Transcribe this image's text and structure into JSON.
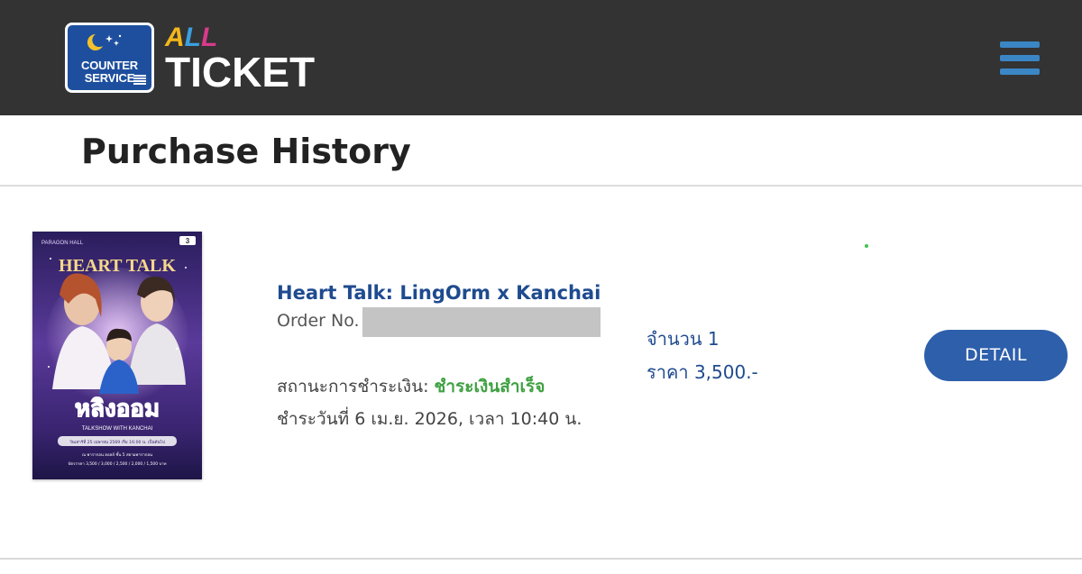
{
  "header": {
    "logo_line1": "COUNTER",
    "logo_line2": "SERVICE",
    "brand_all": [
      "A",
      "L",
      "L"
    ],
    "brand_ticket": "TICKET",
    "menu_icon": "hamburger-menu-icon",
    "colors": {
      "bar": "#333333",
      "menu": "#3b86c4",
      "logo_bg": "#1e4f9e"
    }
  },
  "page": {
    "title": "Purchase History"
  },
  "order": {
    "poster": {
      "venue": "PARAGON HALL",
      "title": "HEART TALK",
      "thai_title": "หลิงออม",
      "subtitle": "TALKSHOW WITH KANCHAI",
      "date_line": "วันเสาร์ที่ 25 เมษายน 2569 เริ่ม 16:00 น. เป็นต้นไป",
      "location_line": "ณ พารากอน ฮอลล์ ชั้น 5 สยามพารากอน",
      "price_line": "บัตรราคา 3,500 / 3,000 / 2,500 / 2,000 / 1,500 บาท",
      "badge": "3"
    },
    "event_name": "Heart Talk: LingOrm x Kanchai",
    "order_no_label": "Order No.",
    "payment_status_label": "สถานะการชำระเงิน:",
    "payment_status_value": "ชำระเงินสำเร็จ",
    "payment_date": "ชำระวันที่ 6 เม.ย. 2026, เวลา 10:40 น.",
    "quantity": "จำนวน 1",
    "price": "ราคา 3,500.-",
    "detail_label": "DETAIL",
    "colors": {
      "event_name": "#1f4b8f",
      "status_ok": "#3fa142",
      "button": "#2d5fab"
    }
  }
}
